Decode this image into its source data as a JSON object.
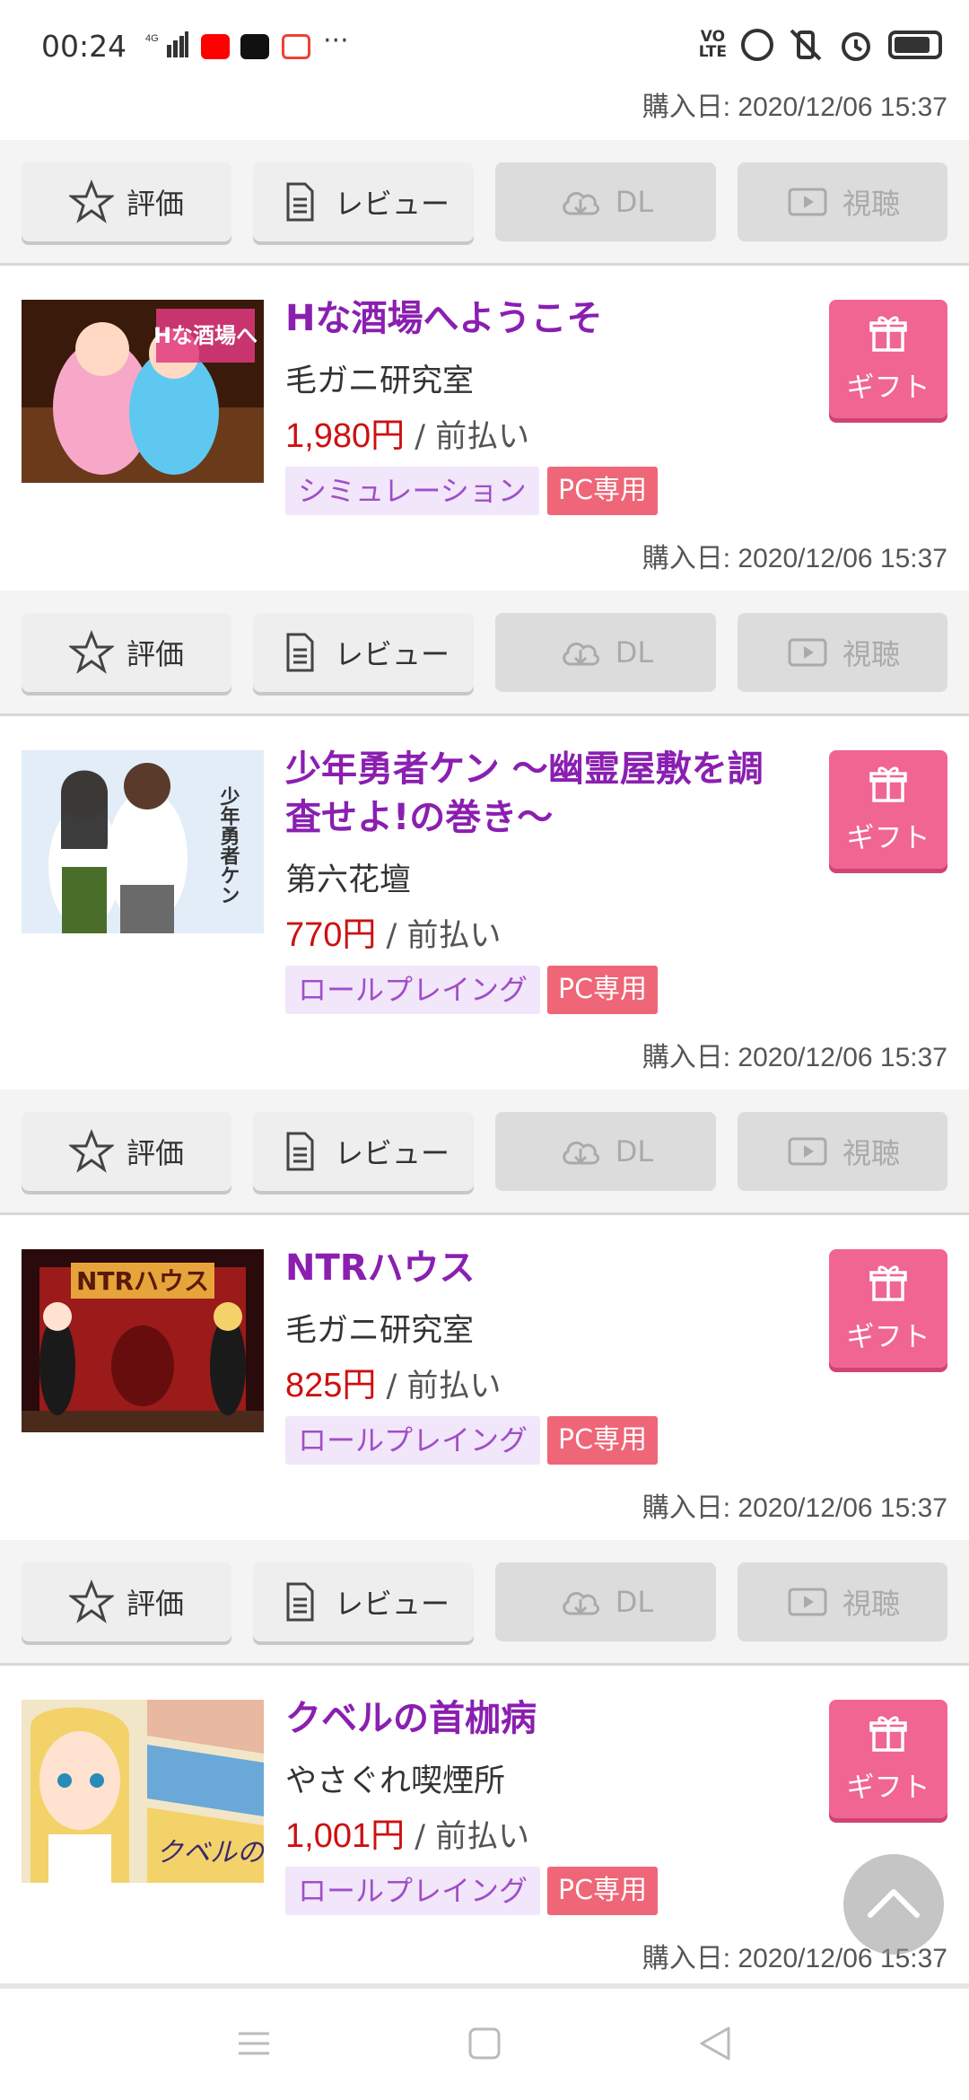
{
  "status_bar": {
    "time": "00:24",
    "network": "4G",
    "volte": "VO\nLTE",
    "more": "···"
  },
  "labels": {
    "purchase_prefix": "購入日: ",
    "rate": "評価",
    "review": "レビュー",
    "download": "DL",
    "watch": "視聴",
    "gift": "ギフト",
    "payment": " / 前払い",
    "pc_only": "PC専用"
  },
  "top_date": "購入日: 2020/12/06 15:37",
  "items": [
    {
      "title": "Hな酒場へようこそ",
      "maker": "毛ガニ研究室",
      "price": "1,980円",
      "payment": " / 前払い",
      "genre": "シミュレーション",
      "pc_tag": "PC専用",
      "purchase_date": "購入日: 2020/12/06 15:37",
      "thumb_colors": [
        "#3a1a0a",
        "#8a4a1a",
        "#f7a8c8",
        "#5ec8f0"
      ]
    },
    {
      "title": "少年勇者ケン ～幽霊屋敷を調査せよ!の巻き～",
      "maker": "第六花壇",
      "price": "770円",
      "payment": " / 前払い",
      "genre": "ロールプレイング",
      "pc_tag": "PC専用",
      "purchase_date": "購入日: 2020/12/06 15:37",
      "thumb_colors": [
        "#d6e6f4",
        "#ffffff",
        "#2b2b2b",
        "#4a6e2a"
      ]
    },
    {
      "title": "NTRハウス",
      "maker": "毛ガニ研究室",
      "price": "825円",
      "payment": " / 前払い",
      "genre": "ロールプレイング",
      "pc_tag": "PC専用",
      "purchase_date": "購入日: 2020/12/06 15:37",
      "thumb_colors": [
        "#2a0a0a",
        "#9b1a1a",
        "#e7a43a",
        "#1a1a1a"
      ]
    },
    {
      "title": "クベルの首枷病",
      "maker": "やさぐれ喫煙所",
      "price": "1,001円",
      "payment": " / 前払い",
      "genre": "ロールプレイング",
      "pc_tag": "PC専用",
      "purchase_date": "購入日: 2020/12/06 15:37",
      "thumb_colors": [
        "#f2e6c8",
        "#f4d26a",
        "#6aa8d8",
        "#e8b8a0"
      ]
    }
  ],
  "icons": {
    "rate": "star-icon",
    "review": "document-icon",
    "download": "cloud-download-icon",
    "watch": "play-icon",
    "gift": "gift-icon",
    "scroll_top": "chevron-up-icon",
    "nav_menu": "menu-icon",
    "nav_home": "home-square-icon",
    "nav_back": "back-triangle-icon"
  },
  "colors": {
    "title": "#8a1fb0",
    "price": "#cc1111",
    "gift": "#f06592",
    "pc_tag": "#ee6677",
    "genre_bg": "#f2e6fa",
    "genre_text": "#a04fc8"
  }
}
